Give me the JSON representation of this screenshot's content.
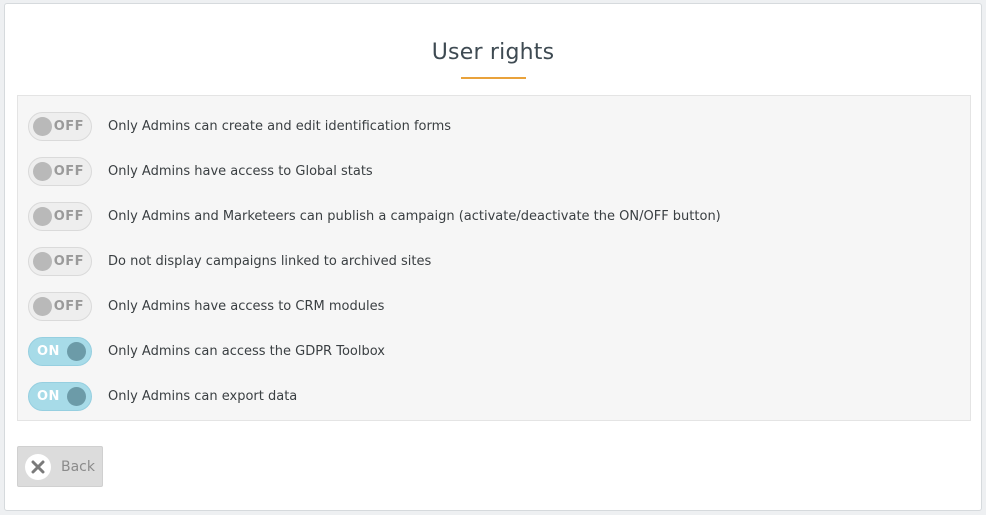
{
  "page": {
    "title": "User rights"
  },
  "toggles": [
    {
      "state": "OFF",
      "label": "Only Admins can create and edit identification forms"
    },
    {
      "state": "OFF",
      "label": "Only Admins have access to Global stats"
    },
    {
      "state": "OFF",
      "label": "Only Admins and Marketeers can publish a campaign (activate/deactivate the ON/OFF button)"
    },
    {
      "state": "OFF",
      "label": "Do not display campaigns linked to archived sites"
    },
    {
      "state": "OFF",
      "label": "Only Admins have access to CRM modules"
    },
    {
      "state": "ON",
      "label": "Only Admins can access the GDPR Toolbox"
    },
    {
      "state": "ON",
      "label": "Only Admins can export data"
    }
  ],
  "footer": {
    "back_label": "Back",
    "back_icon": "close-icon"
  },
  "colors": {
    "accent_underline": "#e9a23b",
    "toggle_on_bg": "#a7dbe8",
    "toggle_on_knob": "#6c9ba8",
    "toggle_off_bg": "#eeeeee",
    "toggle_off_knob": "#b9b9b9"
  }
}
